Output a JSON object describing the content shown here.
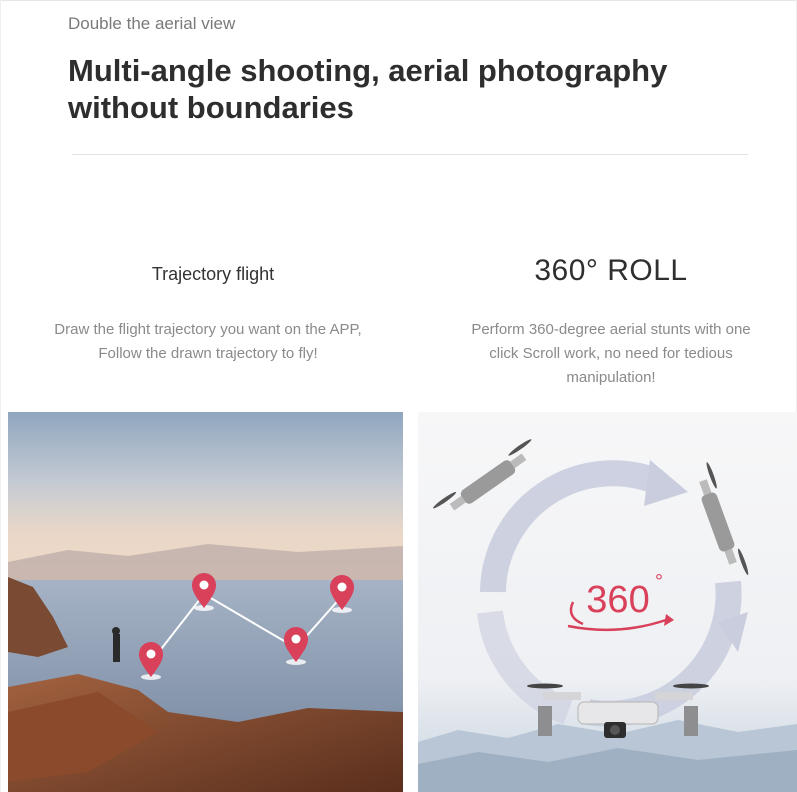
{
  "header": {
    "eyebrow": "Double the aerial view",
    "headline_line1": "Multi-angle shooting, aerial photography",
    "headline_line2": "without boundaries"
  },
  "features": [
    {
      "title": "Trajectory flight",
      "desc_line1": "Draw the flight trajectory you want on the APP,",
      "desc_line2": "Follow the drawn trajectory to fly!"
    },
    {
      "title": "360° ROLL",
      "desc_line1": "Perform 360-degree aerial stunts with one",
      "desc_line2": "click Scroll work, no need for tedious",
      "desc_line3": "manipulation!"
    }
  ],
  "roll_badge": {
    "label": "360",
    "degree_mark": "°"
  },
  "colors": {
    "headline": "#2e2e2e",
    "body_text": "#8a8a8a",
    "pin": "#d9405a",
    "badge": "#d9405a"
  },
  "icons": [
    "location-pin-icon",
    "rotation-arrows-icon",
    "drone-icon"
  ]
}
